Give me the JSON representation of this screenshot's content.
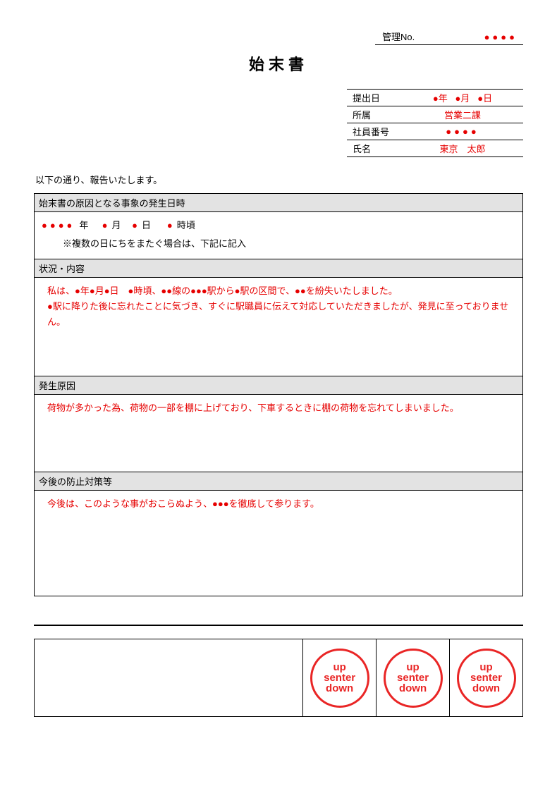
{
  "management": {
    "label": "管理No.",
    "value": "●●●●"
  },
  "title": "始末書",
  "header": {
    "rows": [
      {
        "label": "提出日",
        "value_html": "●年　●月　●日",
        "red": true
      },
      {
        "label": "所属",
        "value": "営業二課",
        "red": true
      },
      {
        "label": "社員番号",
        "value": "●●●●",
        "red": true
      },
      {
        "label": "氏名",
        "value": "東京　太郎",
        "red": true
      }
    ]
  },
  "intro": "以下の通り、報告いたします。",
  "sections": {
    "event": {
      "heading": "始末書の原因となる事象の発生日時",
      "line_parts": {
        "yyyy": "●●●●",
        "y": "年",
        "mm": "●",
        "m": "月",
        "dd": "●",
        "d": "日",
        "hh": "●",
        "h": "時頃"
      },
      "note": "※複数の日にちをまたぐ場合は、下記に記入"
    },
    "situation": {
      "heading": "状況・内容",
      "lines": [
        "私は、●年●月●日　●時頃、●●線の●●●駅から●駅の区間で、●●を紛失いたしました。",
        "●駅に降りた後に忘れたことに気づき、すぐに駅職員に伝えて対応していただきましたが、発見に至っておりません。"
      ]
    },
    "cause": {
      "heading": "発生原因",
      "lines": [
        "荷物が多かった為、荷物の一部を棚に上げており、下車するときに棚の荷物を忘れてしまいました。"
      ]
    },
    "prevention": {
      "heading": "今後の防止対策等",
      "lines": [
        "今後は、このような事がおこらぬよう、●●●を徹底して参ります。"
      ]
    }
  },
  "stamps": [
    {
      "l1": "up",
      "l2": "senter",
      "l3": "down"
    },
    {
      "l1": "up",
      "l2": "senter",
      "l3": "down"
    },
    {
      "l1": "up",
      "l2": "senter",
      "l3": "down"
    }
  ]
}
